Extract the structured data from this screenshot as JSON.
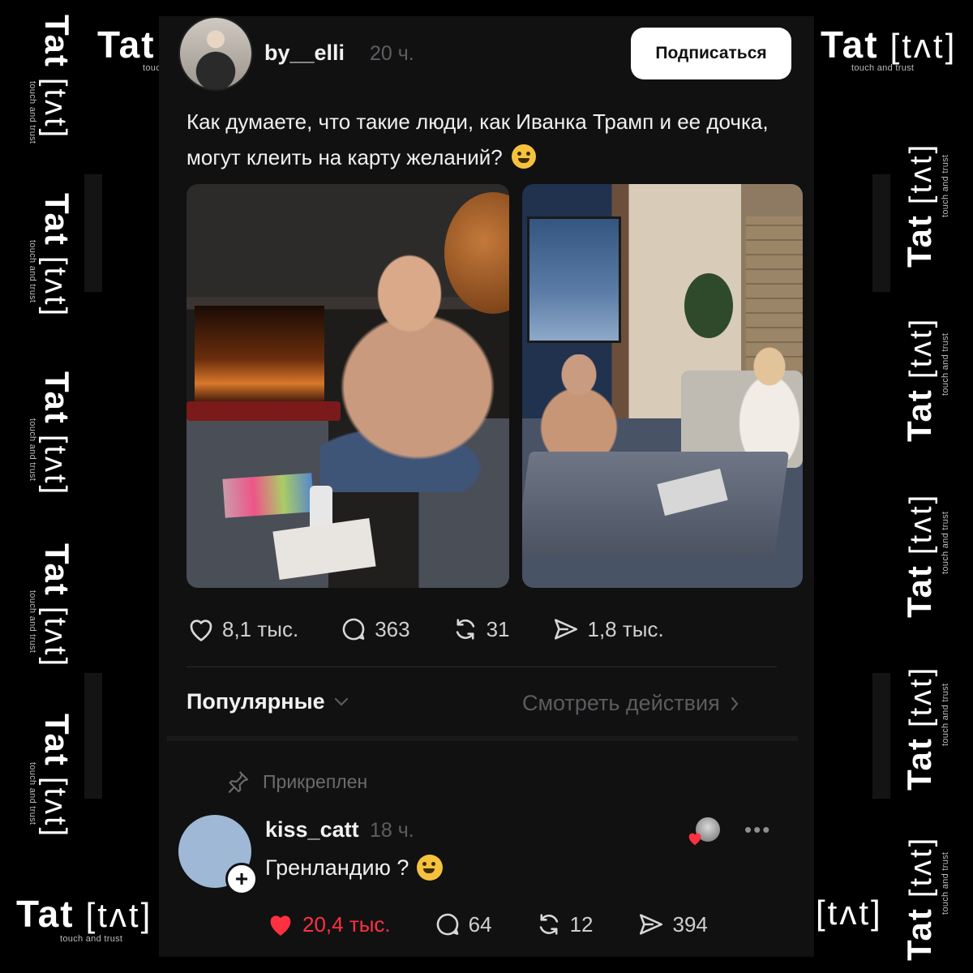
{
  "watermark": {
    "brand": "Tat",
    "logo": "[tʌt]",
    "tagline": "touch and trust"
  },
  "post": {
    "username": "by__elli",
    "time": "20 ч.",
    "follow_label": "Подписаться",
    "text": "Как думаете, что такие люди, как Иванка Трамп и ее дочка, могут клеить на карту желаний?",
    "text_emoji": "sweat-smile-emoji",
    "stats": {
      "likes": "8,1 тыс.",
      "comments": "363",
      "reposts": "31",
      "shares": "1,8 тыс."
    }
  },
  "comments_header": {
    "sort_label": "Популярные",
    "view_activity": "Смотреть действия"
  },
  "comment": {
    "pinned_label": "Прикреплен",
    "username": "kiss_catt",
    "time": "18 ч.",
    "text": "Гренландию ?",
    "text_emoji": "grinning-emoji",
    "stats": {
      "likes": "20,4 тыс.",
      "comments": "64",
      "reposts": "12",
      "shares": "394"
    },
    "liked_color": "#ff3040"
  },
  "colors": {
    "background": "#000000",
    "panel": "#111112",
    "muted_text": "#5e5e62",
    "like_red": "#ff3040"
  }
}
